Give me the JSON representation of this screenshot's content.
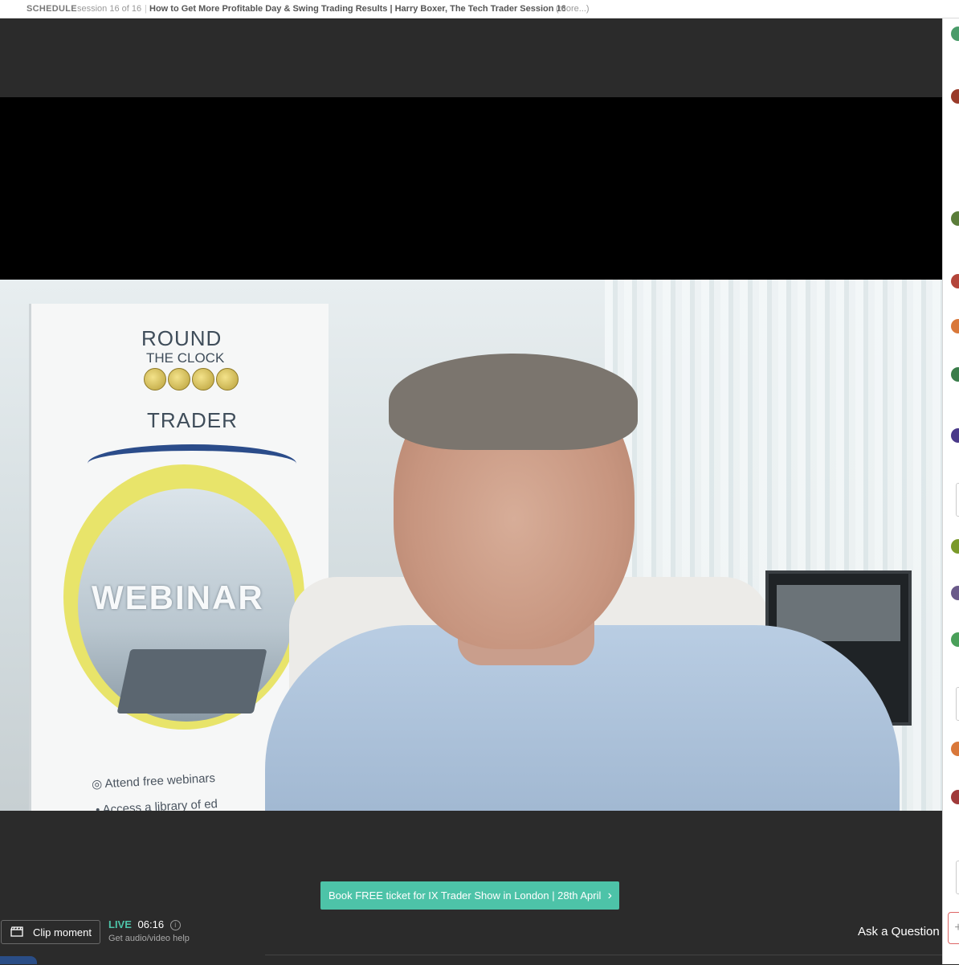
{
  "schedule_bar": {
    "label": "SCHEDULE",
    "session": "session 16 of 16",
    "separator": "|",
    "title": "How to Get More Profitable Day & Swing Trading Results | Harry Boxer, The Tech Trader Session 16",
    "more": "(more...)"
  },
  "video": {
    "banner": {
      "brand_line1": "ROUND",
      "brand_line2": "THE CLOCK",
      "brand_line3": "TRADER",
      "webinar": "WEBINAR",
      "bullet1": "◎ Attend free webinars",
      "bullet2": "• Access a library of ed"
    }
  },
  "cta": {
    "label": "Book FREE ticket for IX Trader Show in London | 28th April",
    "chevron": "›",
    "color": "#4dc3a8"
  },
  "controls": {
    "clip_label": "Clip moment",
    "live_tag": "LIVE",
    "live_time": "06:16",
    "info_glyph": "i",
    "help_link": "Get audio/video help",
    "ask_label": "Ask a Question",
    "add_glyph": "+"
  },
  "colors": {
    "background": "#2b2b2b",
    "accent": "#4dc3a8"
  }
}
